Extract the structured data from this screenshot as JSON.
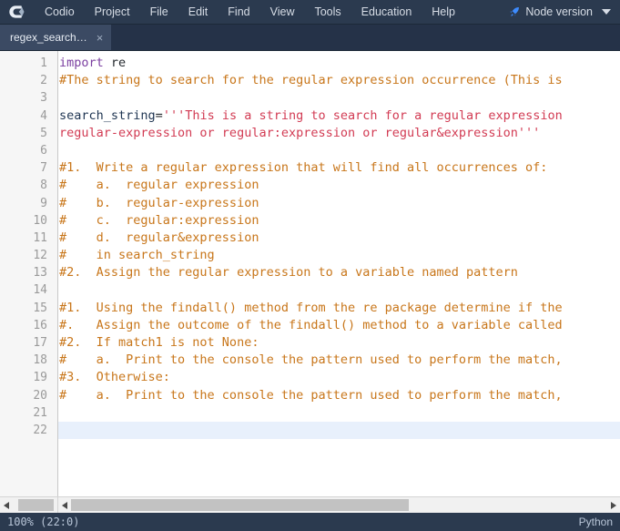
{
  "menubar": {
    "logo_name": "codio-logo",
    "items": [
      {
        "label": "Codio"
      },
      {
        "label": "Project"
      },
      {
        "label": "File"
      },
      {
        "label": "Edit"
      },
      {
        "label": "Find"
      },
      {
        "label": "View"
      },
      {
        "label": "Tools"
      },
      {
        "label": "Education"
      },
      {
        "label": "Help"
      }
    ],
    "node_version_label": "Node version",
    "rocket_icon": "rocket-icon",
    "caret_icon": "chevron-down-icon",
    "bg_color": "#2b3a4f"
  },
  "tabbar": {
    "tabs": [
      {
        "label": "regex_search…",
        "close_label": "×",
        "active": true
      }
    ]
  },
  "editor": {
    "active_line": 22,
    "total_lines": 22,
    "line_numbers": [
      1,
      2,
      3,
      4,
      5,
      6,
      7,
      8,
      9,
      10,
      11,
      12,
      13,
      14,
      15,
      16,
      17,
      18,
      19,
      20,
      21,
      22
    ],
    "lines": [
      {
        "n": 1,
        "tokens": [
          {
            "t": "import",
            "c": "kw"
          },
          {
            "t": " re",
            "c": "plain"
          }
        ]
      },
      {
        "n": 2,
        "tokens": [
          {
            "t": "#The string to search for the regular expression occurrence (This is",
            "c": "com"
          }
        ]
      },
      {
        "n": 3,
        "tokens": []
      },
      {
        "n": 4,
        "tokens": [
          {
            "t": "search_string",
            "c": "var"
          },
          {
            "t": "=",
            "c": "plain"
          },
          {
            "t": "'''This is a string to search for a regular expression",
            "c": "str"
          }
        ]
      },
      {
        "n": 5,
        "tokens": [
          {
            "t": "regular-expression or regular:expression or regular&expression'''",
            "c": "str"
          }
        ]
      },
      {
        "n": 6,
        "tokens": []
      },
      {
        "n": 7,
        "tokens": [
          {
            "t": "#1.  Write a regular expression that will find all occurrences of:",
            "c": "com"
          }
        ]
      },
      {
        "n": 8,
        "tokens": [
          {
            "t": "#    a.  regular expression",
            "c": "com"
          }
        ]
      },
      {
        "n": 9,
        "tokens": [
          {
            "t": "#    b.  regular-expression",
            "c": "com"
          }
        ]
      },
      {
        "n": 10,
        "tokens": [
          {
            "t": "#    c.  regular:expression",
            "c": "com"
          }
        ]
      },
      {
        "n": 11,
        "tokens": [
          {
            "t": "#    d.  regular&expression",
            "c": "com"
          }
        ]
      },
      {
        "n": 12,
        "tokens": [
          {
            "t": "#    in search_string",
            "c": "com"
          }
        ]
      },
      {
        "n": 13,
        "tokens": [
          {
            "t": "#2.  Assign the regular expression to a variable named pattern",
            "c": "com"
          }
        ]
      },
      {
        "n": 14,
        "tokens": []
      },
      {
        "n": 15,
        "tokens": [
          {
            "t": "#1.  Using the findall() method from the re package determine if the",
            "c": "com"
          }
        ]
      },
      {
        "n": 16,
        "tokens": [
          {
            "t": "#.   Assign the outcome of the findall() method to a variable called",
            "c": "com"
          }
        ]
      },
      {
        "n": 17,
        "tokens": [
          {
            "t": "#2.  If match1 is not None:",
            "c": "com"
          }
        ]
      },
      {
        "n": 18,
        "tokens": [
          {
            "t": "#    a.  Print to the console the pattern used to perform the match,",
            "c": "com"
          }
        ]
      },
      {
        "n": 19,
        "tokens": [
          {
            "t": "#3.  Otherwise:",
            "c": "com"
          }
        ]
      },
      {
        "n": 20,
        "tokens": [
          {
            "t": "#    a.  Print to the console the pattern used to perform the match,",
            "c": "com"
          }
        ]
      },
      {
        "n": 21,
        "tokens": []
      },
      {
        "n": 22,
        "tokens": []
      }
    ],
    "colors": {
      "keyword": "#7b3fa0",
      "comment": "#c8761a",
      "string": "#d23b53",
      "variable": "#1f3552",
      "plain": "#24292e",
      "active_line_bg": "#e8f0fc",
      "gutter_bg": "#f6f6f6",
      "gutter_fg": "#9a9a9a"
    }
  },
  "scrollbars": {
    "gutter": {
      "left_arrow": "◀",
      "thumb_left_pct": 13,
      "thumb_width_pct": 78
    },
    "main": {
      "left_arrow": "◀",
      "right_arrow": "▶",
      "thumb_left_pct": 0,
      "thumb_width_pct": 63
    }
  },
  "statusbar": {
    "left": "100%  (22:0)",
    "right": "Python"
  }
}
